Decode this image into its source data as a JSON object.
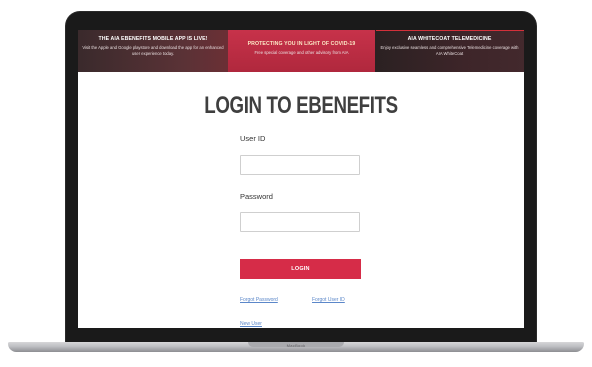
{
  "banner": {
    "left": {
      "title": "THE AIA EBENEFITS MOBILE APP IS LIVE!",
      "text": "Visit the Apple and Google playstore and download the app for an enhanced user experience today."
    },
    "middle": {
      "title": "PROTECTING YOU IN LIGHT OF COVID-19",
      "text": "Free special coverage and other advisory from AIA"
    },
    "right": {
      "title": "AIA WHITECOAT TELEMEDICINE",
      "text": "Enjoy exclusive seamless and comprehensive Telemedicine coverage with AIA WhiteCoat"
    }
  },
  "login": {
    "title": "LOGIN TO EBENEFITS",
    "user_id_label": "User ID",
    "user_id_value": "",
    "password_label": "Password",
    "password_value": "",
    "button_label": "LOGIN",
    "forgot_password": "Forgot Password",
    "forgot_user_id": "Forgot User ID",
    "new_user": "New User"
  },
  "device": {
    "brand": "MacBook"
  },
  "colors": {
    "accent": "#d62c48",
    "link": "#5b87c9"
  }
}
